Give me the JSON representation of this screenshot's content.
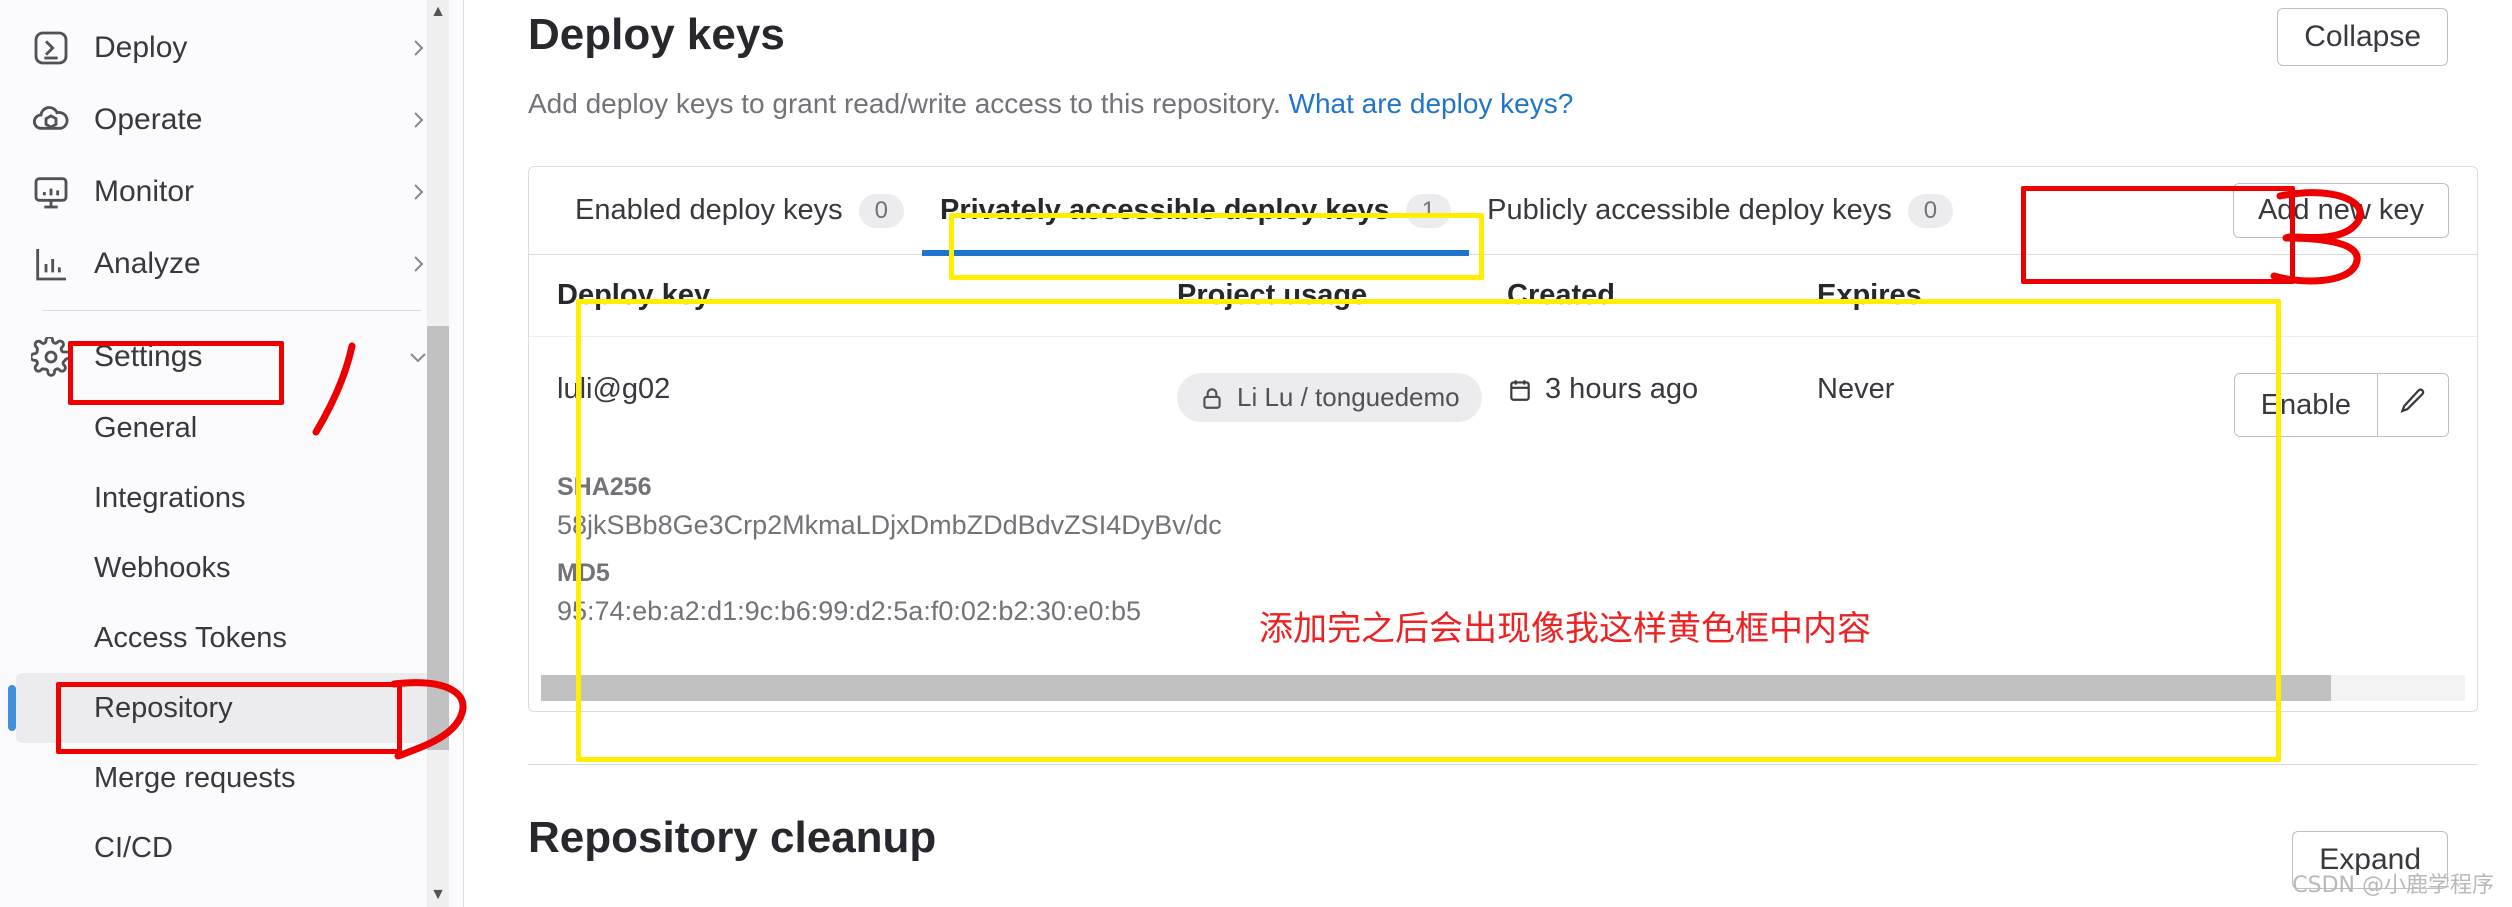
{
  "sidebar": {
    "nav_items": [
      {
        "label": "Deploy",
        "icon": "rocket-deploy-icon",
        "chevron": "chevron-right"
      },
      {
        "label": "Operate",
        "icon": "cloud-cube-icon",
        "chevron": "chevron-right"
      },
      {
        "label": "Monitor",
        "icon": "monitor-icon",
        "chevron": "chevron-right"
      },
      {
        "label": "Analyze",
        "icon": "analytics-icon",
        "chevron": "chevron-right"
      },
      {
        "label": "Settings",
        "icon": "gear-icon",
        "chevron": "chevron-down"
      }
    ],
    "sub_items": [
      {
        "label": "General",
        "active": false
      },
      {
        "label": "Integrations",
        "active": false
      },
      {
        "label": "Webhooks",
        "active": false
      },
      {
        "label": "Access Tokens",
        "active": false
      },
      {
        "label": "Repository",
        "active": true
      },
      {
        "label": "Merge requests",
        "active": false
      },
      {
        "label": "CI/CD",
        "active": false
      }
    ],
    "scroll_up_glyph": "▲",
    "scroll_down_glyph": "▼"
  },
  "header": {
    "title": "Deploy keys",
    "description": "Add deploy keys to grant read/write access to this repository.",
    "help_link": "What are deploy keys?",
    "collapse_label": "Collapse",
    "expand_label": "Expand"
  },
  "tabs": [
    {
      "label": "Enabled deploy keys",
      "count": "0",
      "active": false
    },
    {
      "label": "Privately accessible deploy keys",
      "count": "1",
      "active": true
    },
    {
      "label": "Publicly accessible deploy keys",
      "count": "0",
      "active": false
    }
  ],
  "add_key_label": "Add new key",
  "table": {
    "columns": [
      "Deploy key",
      "Project usage",
      "Created",
      "Expires"
    ],
    "rows": [
      {
        "key_name": "luli@g02",
        "project_usage": "Li Lu / tonguedemo",
        "project_usage_icon": "lock-icon",
        "created": "3 hours ago",
        "created_icon": "calendar-icon",
        "expires": "Never",
        "enable_label": "Enable",
        "edit_icon": "pencil-icon",
        "fingerprints": [
          {
            "label": "SHA256",
            "value": "58jkSBb8Ge3Crp2MkmaLDjxDmbZDdBdvZSI4DyBv/dc"
          },
          {
            "label": "MD5",
            "value": "95:74:eb:a2:d1:9c:b6:99:d2:5a:f0:02:b2:30:e0:b5"
          }
        ]
      }
    ]
  },
  "section_below": {
    "title": "Repository cleanup"
  },
  "annotations": {
    "chinese_note": "添加完之后会出现像我这样黄色框中内容",
    "colors": {
      "red": "#ee0000",
      "yellow": "#ffee00",
      "accent_blue": "#1f75cb",
      "link_blue": "#1f75cb"
    }
  },
  "watermark": "CSDN @小鹿学程序"
}
